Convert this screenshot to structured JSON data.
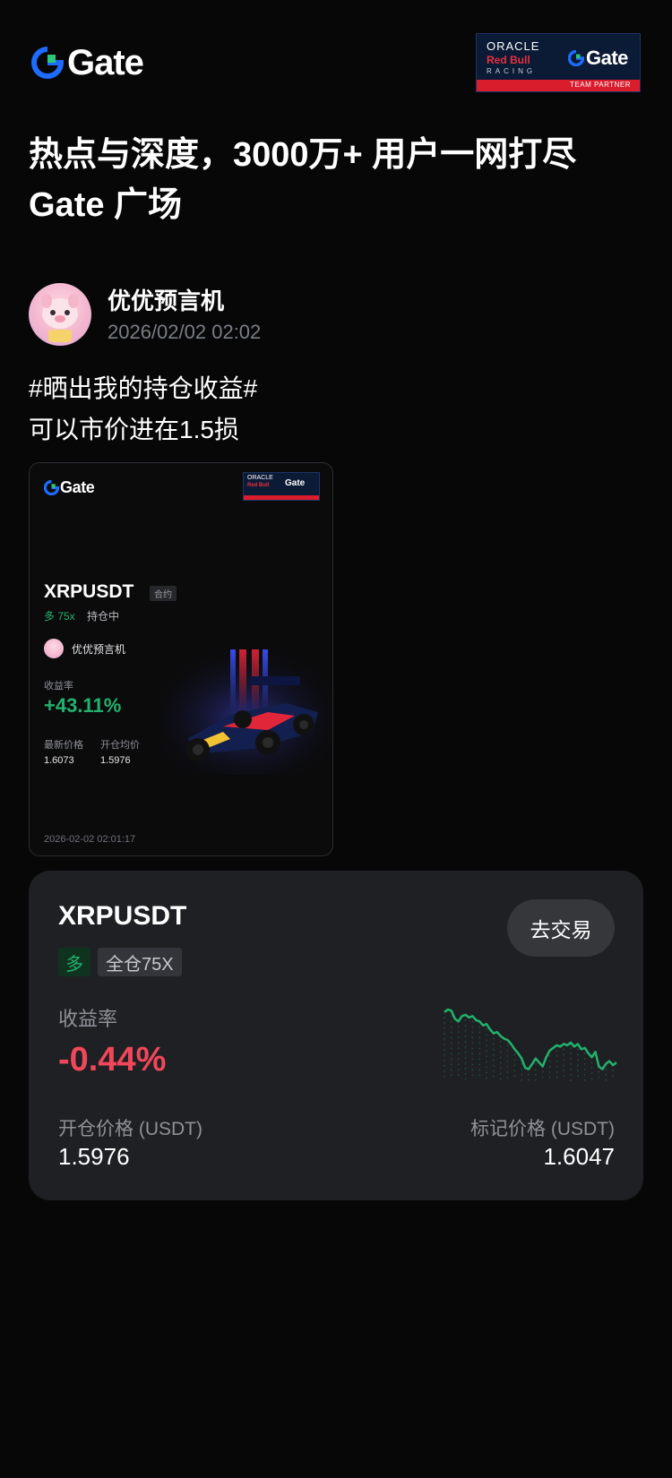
{
  "header": {
    "brand": "Gate",
    "partner": {
      "line1": "ORACLE",
      "line2": "Red Bull",
      "line3": "RACING",
      "brand": "Gate",
      "badge": "TEAM PARTNER"
    }
  },
  "headline": {
    "line1": "热点与深度，3000万+ 用户一网打尽",
    "line2": "Gate 广场"
  },
  "author": {
    "name": "优优预言机",
    "time": "2026/02/02 02:02"
  },
  "post": {
    "line1": "#晒出我的持仓收益#",
    "line2": "可以市价进在1.5损"
  },
  "share_card": {
    "brand": "Gate",
    "partner": {
      "line1": "ORACLE",
      "line2": "Red Bull",
      "brand": "Gate"
    },
    "pair": "XRPUSDT",
    "tag": "合约",
    "side": "多 75x",
    "status": "持仓中",
    "user": "优优预言机",
    "rate_label": "收益率",
    "rate": "+43.11%",
    "last_label": "最新价格",
    "open_label": "开仓均价",
    "last_value": "1.6073",
    "open_value": "1.5976",
    "timestamp": "2026-02-02 02:01:17"
  },
  "position_card": {
    "pair": "XRPUSDT",
    "trade_button": "去交易",
    "side": "多",
    "leverage": "全仓75X",
    "rate_label": "收益率",
    "rate": "-0.44%",
    "open_label": "开仓价格 (USDT)",
    "open_value": "1.5976",
    "mark_label": "标记价格 (USDT)",
    "mark_value": "1.6047",
    "sparkline": [
      0.92,
      0.96,
      0.94,
      0.82,
      0.78,
      0.86,
      0.88,
      0.84,
      0.86,
      0.8,
      0.78,
      0.72,
      0.74,
      0.66,
      0.6,
      0.62,
      0.56,
      0.52,
      0.5,
      0.44,
      0.36,
      0.3,
      0.22,
      0.08,
      0.06,
      0.14,
      0.22,
      0.16,
      0.1,
      0.24,
      0.34,
      0.38,
      0.42,
      0.4,
      0.44,
      0.42,
      0.46,
      0.4,
      0.44,
      0.36,
      0.38,
      0.3,
      0.24,
      0.32,
      0.1,
      0.06,
      0.14,
      0.18,
      0.12,
      0.16
    ]
  },
  "colors": {
    "background": "#070707",
    "card": "#1f2023",
    "up": "#22b26e",
    "down": "#f0475a",
    "brand_blue": "#1e6bff",
    "brand_green": "#28c77a"
  }
}
